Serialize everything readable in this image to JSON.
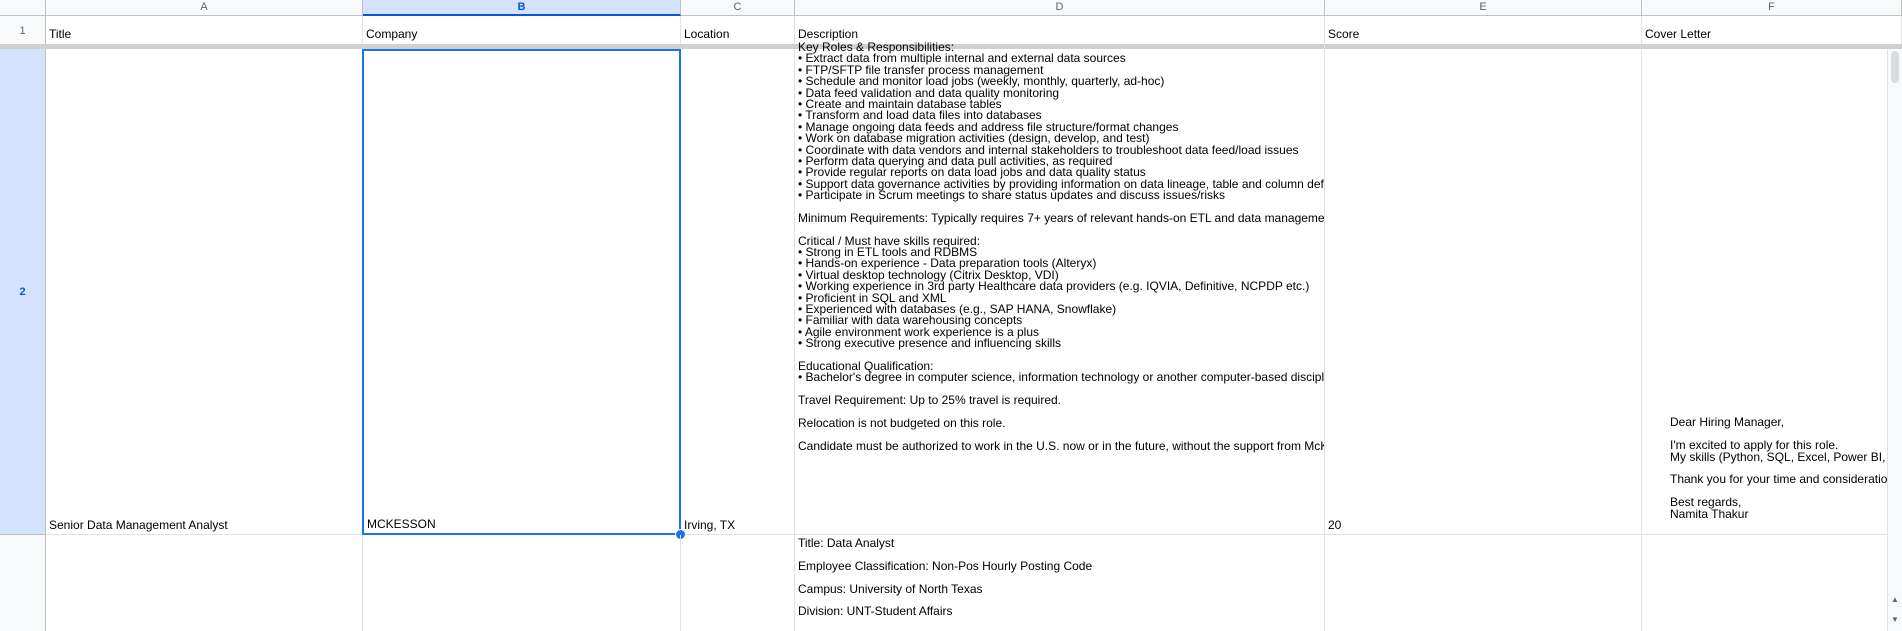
{
  "column_headers": [
    "A",
    "B",
    "C",
    "D",
    "E",
    "F"
  ],
  "row_numbers": [
    "1",
    "2"
  ],
  "header_row": {
    "title": "Title",
    "company": "Company",
    "location": "Location",
    "description": "Description",
    "score": "Score",
    "cover_letter": "Cover Letter"
  },
  "row2": {
    "title": "Senior Data Management Analyst",
    "company": "MCKESSON",
    "location": "Irving, TX",
    "score": "20",
    "description_lines": [
      "Key Roles & Responsibilities:",
      "• Extract data from multiple internal and external data sources",
      "• FTP/SFTP file transfer process management",
      "• Schedule and monitor load jobs (weekly, monthly, quarterly, ad-hoc)",
      "• Data feed validation and data quality monitoring",
      "• Create and maintain database tables",
      "• Transform and load data files into databases",
      "• Manage ongoing data feeds and address file structure/format changes",
      "• Work on database migration activities (design, develop, and test)",
      "• Coordinate with data vendors and internal stakeholders to troubleshoot data feed/load issues",
      "• Perform data querying and data pull activities, as required",
      "• Provide regular reports on data load jobs and data quality status",
      "• Support data governance activities by providing information on data lineage, table and column definit",
      "• Participate in Scrum meetings to share status updates and discuss issues/risks",
      "",
      "Minimum Requirements: Typically requires 7+ years of relevant hands-on ETL and data management",
      "",
      "Critical / Must have skills required:",
      "• Strong in ETL tools and RDBMS",
      "• Hands-on experience - Data preparation tools (Alteryx)",
      "• Virtual desktop technology (Citrix Desktop, VDI)",
      "• Working experience in 3rd party Healthcare data providers (e.g. IQVIA, Definitive, NCPDP etc.)",
      "• Proficient in SQL and XML",
      "• Experienced with databases (e.g., SAP HANA, Snowflake)",
      "• Familiar with data warehousing concepts",
      "• Agile environment work experience is a plus",
      "• Strong executive presence and influencing skills",
      "",
      "Educational Qualification:",
      "• Bachelor's degree in computer science, information technology or another computer-based discipline",
      "",
      "Travel Requirement: Up to 25% travel is required.",
      "",
      "Relocation is not budgeted on this role.",
      "",
      "Candidate must be authorized to work in the U.S. now or in the future, without the support from McKes"
    ],
    "cover_letter_lines": [
      "Dear Hiring Manager,",
      "",
      "I'm excited to apply for this role.",
      "My skills (Python, SQL, Excel, Power BI,",
      "",
      "Thank you for your time and consideratio",
      "",
      "Best regards,",
      "Namita Thakur"
    ]
  },
  "row3": {
    "description_lines": [
      "Title: Data Analyst",
      "",
      "Employee Classification: Non-Pos Hourly Posting Code",
      "",
      "Campus: University of North Texas",
      "",
      "Division: UNT-Student Affairs"
    ]
  },
  "colors": {
    "selection": "#1a73e8",
    "header_selected_bg": "#d3e3fd",
    "header_bg": "#f8f9fa",
    "grid": "#e2e2e2"
  }
}
